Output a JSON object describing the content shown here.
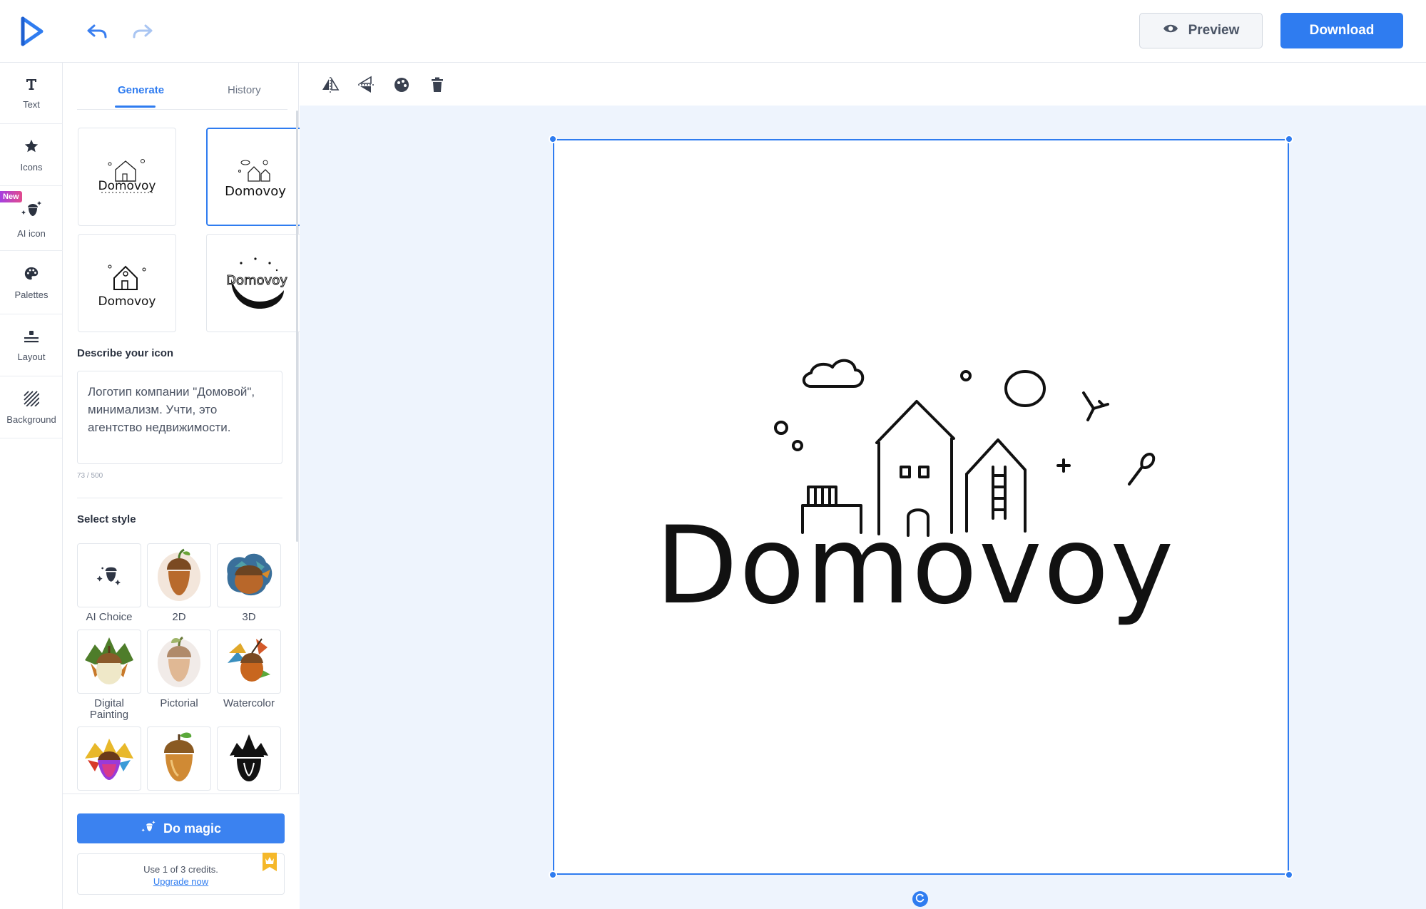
{
  "header": {
    "logo_icon": "play-triangle-logo-icon",
    "undo_icon": "undo-icon",
    "redo_icon": "redo-icon",
    "preview_label": "Preview",
    "download_label": "Download",
    "accent": "#2f7cf0"
  },
  "rail": {
    "items": [
      {
        "label": "Text",
        "icon": "text-icon"
      },
      {
        "label": "Icons",
        "icon": "star-icon"
      },
      {
        "label": "AI icon",
        "icon": "ai-acorn-icon",
        "badge": "New"
      },
      {
        "label": "Palettes",
        "icon": "palette-icon"
      },
      {
        "label": "Layout",
        "icon": "layout-icon"
      },
      {
        "label": "Background",
        "icon": "background-hatch-icon"
      }
    ]
  },
  "panel": {
    "tabs": [
      {
        "label": "Generate",
        "active": true
      },
      {
        "label": "History",
        "active": false
      }
    ],
    "thumb_text": "Domovoy",
    "describe_title": "Describe your icon",
    "description": "Логотип компании \"Домовой\", минимализм. Учти, это агентство недвижимости.",
    "char_count": "73 / 500",
    "style_title": "Select style",
    "styles": [
      {
        "label": "AI Choice"
      },
      {
        "label": "2D"
      },
      {
        "label": "3D"
      },
      {
        "label": "Digital Painting"
      },
      {
        "label": "Pictorial"
      },
      {
        "label": "Watercolor"
      }
    ],
    "magic_label": "Do magic",
    "credits_text": "Use 1 of 3 credits.",
    "upgrade_label": "Upgrade now"
  },
  "toolbar": {
    "tools": [
      "flip-horizontal-icon",
      "flip-vertical-icon",
      "color-fill-icon",
      "trash-icon"
    ]
  },
  "canvas": {
    "logo_text": "Domovoy"
  }
}
